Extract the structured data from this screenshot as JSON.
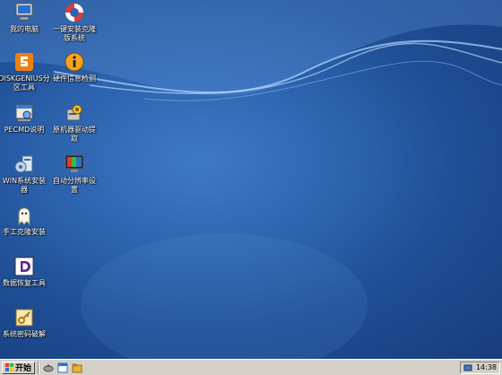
{
  "desktop": {
    "icons": [
      {
        "label": "我的电脑",
        "icon": "computer-icon"
      },
      {
        "label": "一键安装克隆\n版系统",
        "icon": "lifebuoy-icon"
      },
      {
        "label": "DISKGENIUS分\n区工具",
        "icon": "diskgenius-icon"
      },
      {
        "label": "硬件信息检测",
        "icon": "info-icon"
      },
      {
        "label": "PECMD说明",
        "icon": "pecmd-icon"
      },
      {
        "label": "原机器驱动提\n取",
        "icon": "driver-icon"
      },
      {
        "label": "WIN系统安装\n器",
        "icon": "installer-icon"
      },
      {
        "label": "自动分辨率设\n置",
        "icon": "monitor-icon"
      },
      {
        "label": "手工克隆安装",
        "icon": "ghost-icon"
      },
      {
        "label": "数据恢复工具",
        "icon": "recovery-icon"
      },
      {
        "label": "系统密码破解",
        "icon": "key-icon"
      }
    ]
  },
  "taskbar": {
    "start_label": "开始",
    "quick_launch": [
      "eject-icon",
      "window-icon",
      "folder-icon"
    ],
    "clock": "14:38"
  },
  "colors": {
    "desktop": "#2d63ae",
    "taskbar": "#d4d0c8"
  }
}
